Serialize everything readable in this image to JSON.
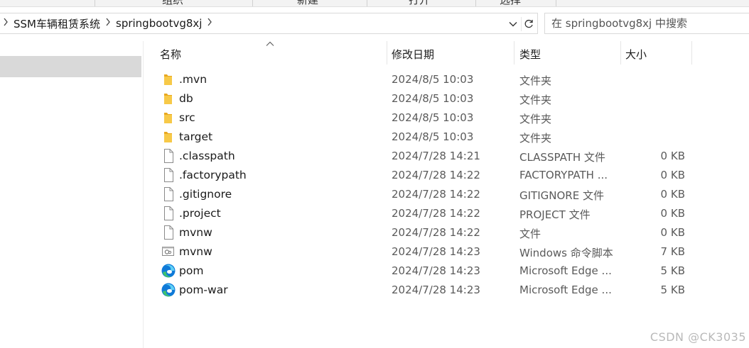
{
  "ribbon": {
    "tabs": [
      "组织",
      "新建",
      "打开",
      "选择"
    ]
  },
  "address": {
    "breadcrumbs": [
      "SSM车辆租赁系统",
      "springbootvg8xj"
    ]
  },
  "search": {
    "placeholder": "在 springbootvg8xj 中搜索"
  },
  "columns": {
    "name": "名称",
    "date": "修改日期",
    "type": "类型",
    "size": "大小"
  },
  "files": [
    {
      "name": ".mvn",
      "date": "2024/8/5 10:03",
      "type": "文件夹",
      "size": "",
      "icon": "folder-icon"
    },
    {
      "name": "db",
      "date": "2024/8/5 10:03",
      "type": "文件夹",
      "size": "",
      "icon": "folder-icon"
    },
    {
      "name": "src",
      "date": "2024/8/5 10:03",
      "type": "文件夹",
      "size": "",
      "icon": "folder-icon"
    },
    {
      "name": "target",
      "date": "2024/8/5 10:03",
      "type": "文件夹",
      "size": "",
      "icon": "folder-icon"
    },
    {
      "name": ".classpath",
      "date": "2024/7/28 14:21",
      "type": "CLASSPATH 文件",
      "size": "0 KB",
      "icon": "file-icon"
    },
    {
      "name": ".factorypath",
      "date": "2024/7/28 14:22",
      "type": "FACTORYPATH ...",
      "size": "0 KB",
      "icon": "file-icon"
    },
    {
      "name": ".gitignore",
      "date": "2024/7/28 14:22",
      "type": "GITIGNORE 文件",
      "size": "0 KB",
      "icon": "file-icon"
    },
    {
      "name": ".project",
      "date": "2024/7/28 14:22",
      "type": "PROJECT 文件",
      "size": "0 KB",
      "icon": "file-icon"
    },
    {
      "name": "mvnw",
      "date": "2024/7/28 14:22",
      "type": "文件",
      "size": "0 KB",
      "icon": "file-icon"
    },
    {
      "name": "mvnw",
      "date": "2024/7/28 14:23",
      "type": "Windows 命令脚本",
      "size": "7 KB",
      "icon": "cmd-script-icon"
    },
    {
      "name": "pom",
      "date": "2024/7/28 14:23",
      "type": "Microsoft Edge ...",
      "size": "5 KB",
      "icon": "edge-icon"
    },
    {
      "name": "pom-war",
      "date": "2024/7/28 14:23",
      "type": "Microsoft Edge ...",
      "size": "5 KB",
      "icon": "edge-icon"
    }
  ],
  "watermark": "CSDN @CK3035",
  "colors": {
    "folder": "#f7c948",
    "folder_dark": "#e8a820",
    "edge_blue": "#0f7ad8",
    "edge_green": "#3fc36e",
    "selection": "#d9d9d9"
  }
}
